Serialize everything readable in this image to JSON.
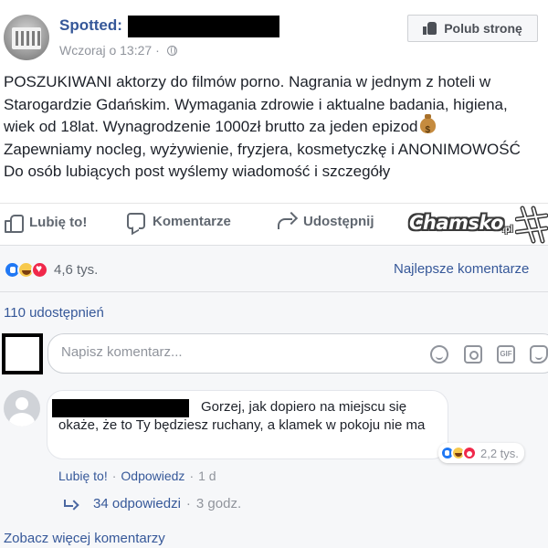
{
  "post": {
    "page_name": "Spotted:",
    "timestamp": "Wczoraj o 13:27",
    "separator": "·",
    "like_page_button": "Polub stronę",
    "text_lines": [
      "POSZUKIWANI aktorzy do filmów porno. Nagrania w jednym z hoteli w",
      "Starogardzie Gdańskim. Wymagania zdrowie i aktualne badania, higiena,",
      "wiek od 18lat. Wynagrodzenie 1000zł brutto za jeden epizod",
      "Zapewniamy nocleg, wyżywienie, fryzjera, kosmetyczkę i ANONIMOWOŚĆ",
      "Do osób lubiących post wyślemy wiadomość i szczegóły"
    ]
  },
  "actions": {
    "like": "Lubię to!",
    "comment": "Komentarze",
    "share": "Udostępnij"
  },
  "watermark": {
    "text": "Chamsko",
    "suffix": ".pl"
  },
  "stats": {
    "reaction_count": "4,6 tys.",
    "sort_label": "Najlepsze komentarze",
    "shares": "110 udostępnień"
  },
  "composer": {
    "placeholder": "Napisz komentarz...",
    "gif_label": "GIF"
  },
  "comment": {
    "text": "Gorzej, jak dopiero na miejscu się okaże, że to Ty będziesz ruchany, a klamek w pokoju nie ma",
    "reaction_count": "2,2 tys.",
    "like": "Lubię to!",
    "reply": "Odpowiedz",
    "dot": "·",
    "age": "1 d",
    "replies_label": "34 odpowiedzi",
    "replies_age": "3 godz."
  },
  "more_comments": "Zobacz więcej komentarzy",
  "colors": {
    "link": "#365899",
    "meta": "#90949c",
    "like_reaction": "#2078f4",
    "haha_reaction": "#f7c94d",
    "love_reaction": "#f0284a"
  },
  "icons": [
    "thumbs-up-icon",
    "globe-icon",
    "money-bag-icon",
    "comment-icon",
    "share-icon",
    "emoji-icon",
    "camera-icon",
    "gif-icon",
    "sticker-icon",
    "reply-arrow-icon"
  ]
}
